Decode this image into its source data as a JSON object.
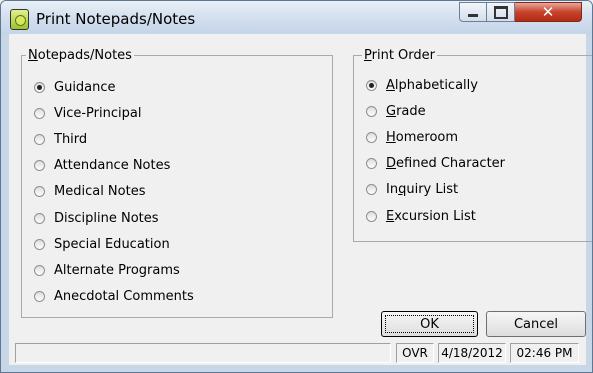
{
  "window": {
    "title": "Print Notepads/Notes",
    "controls": {
      "minimize": "—",
      "maximize": "□",
      "close": "✕"
    }
  },
  "notes_group": {
    "legend_first": "N",
    "legend_rest": "otepads/Notes",
    "options": [
      {
        "label": "Guidance",
        "checked": true
      },
      {
        "label": "Vice-Principal",
        "checked": false
      },
      {
        "label": "Third",
        "checked": false
      },
      {
        "label": "Attendance Notes",
        "checked": false
      },
      {
        "label": "Medical Notes",
        "checked": false
      },
      {
        "label": "Discipline Notes",
        "checked": false
      },
      {
        "label": "Special Education",
        "checked": false
      },
      {
        "label": "Alternate Programs",
        "checked": false
      },
      {
        "label": "Anecdotal Comments",
        "checked": false
      }
    ]
  },
  "order_group": {
    "legend_first": "P",
    "legend_rest": "rint Order",
    "options": [
      {
        "ul": "A",
        "rest": "lphabetically",
        "checked": true
      },
      {
        "ul": "G",
        "rest": "rade",
        "checked": false
      },
      {
        "ul": "H",
        "rest": "omeroom",
        "checked": false
      },
      {
        "ul": "D",
        "rest": "efined Character",
        "checked": false
      },
      {
        "pre": "In",
        "ul": "q",
        "rest": "uiry List",
        "checked": false
      },
      {
        "ul": "E",
        "rest": "xcursion List",
        "checked": false
      }
    ]
  },
  "buttons": {
    "ok": "OK",
    "cancel": "Cancel"
  },
  "status_bar": {
    "message": "",
    "mode": "OVR",
    "date": "4/18/2012",
    "time": "02:46 PM"
  }
}
